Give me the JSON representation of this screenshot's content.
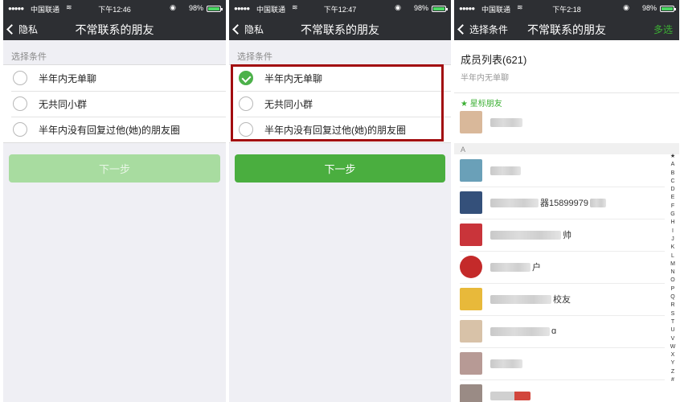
{
  "panels": [
    {
      "status": {
        "signal": "●●●●●",
        "carrier": "中国联通",
        "time": "下午12:46",
        "battery": "98%"
      },
      "nav": {
        "back": "隐私",
        "title": "不常联系的朋友"
      },
      "section_label": "选择条件",
      "options": [
        {
          "label": "半年内无单聊",
          "checked": false
        },
        {
          "label": "无共同小群",
          "checked": false
        },
        {
          "label": "半年内没有回复过他(她)的朋友圈",
          "checked": false
        }
      ],
      "next": "下一步",
      "next_enabled": false
    },
    {
      "status": {
        "signal": "●●●●●",
        "carrier": "中国联通",
        "time": "下午12:47",
        "battery": "98%"
      },
      "nav": {
        "back": "隐私",
        "title": "不常联系的朋友"
      },
      "section_label": "选择条件",
      "options": [
        {
          "label": "半年内无单聊",
          "checked": true
        },
        {
          "label": "无共同小群",
          "checked": false
        },
        {
          "label": "半年内没有回复过他(她)的朋友圈",
          "checked": false
        }
      ],
      "next": "下一步",
      "next_enabled": true
    },
    {
      "status": {
        "signal": "●●●●●",
        "carrier": "中国联通",
        "time": "下午2:18",
        "battery": "98%"
      },
      "nav": {
        "back": "选择条件",
        "title": "不常联系的朋友",
        "right": "多选"
      },
      "member_title": "成员列表(621)",
      "member_sub": "半年内无单聊",
      "star_header": "★ 星标朋友",
      "letter_header": "A",
      "contacts": [
        {
          "name": "",
          "avatar_color": "#d9b89a"
        },
        {
          "name": "",
          "avatar_color": "#6aa0b8"
        },
        {
          "name": "器15899979",
          "avatar_color": "#34507a"
        },
        {
          "name": "帅",
          "avatar_color": "#c9343a"
        },
        {
          "name": "户",
          "avatar_color": "#c42a2a"
        },
        {
          "name": "校友",
          "avatar_color": "#e8b93a"
        },
        {
          "name": "ɑ",
          "avatar_color": "#d8c2a8"
        },
        {
          "name": "",
          "avatar_color": "#b79a95"
        },
        {
          "name": "",
          "avatar_color": "#9a8b85"
        }
      ],
      "index": [
        "★",
        "A",
        "B",
        "C",
        "D",
        "E",
        "F",
        "G",
        "H",
        "I",
        "J",
        "K",
        "L",
        "M",
        "N",
        "O",
        "P",
        "Q",
        "R",
        "S",
        "T",
        "U",
        "V",
        "W",
        "X",
        "Y",
        "Z",
        "#"
      ]
    }
  ],
  "colors": {
    "accent_green": "#4aae3f",
    "nav_bg": "#2d2f33",
    "highlight_red": "#a20d10"
  }
}
